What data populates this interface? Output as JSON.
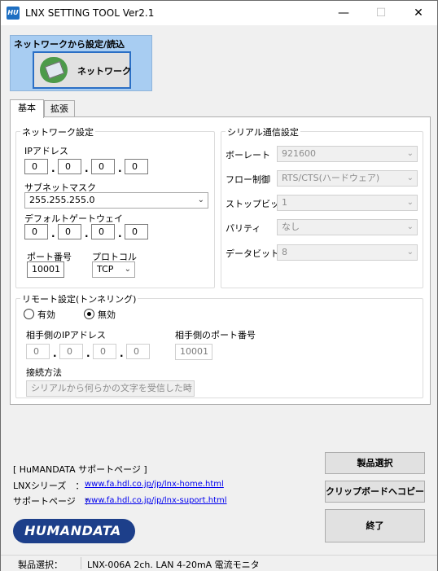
{
  "window": {
    "app_icon": "HU",
    "title": "LNX SETTING TOOL Ver2.1",
    "minimize": "—",
    "maximize": "☐",
    "close": "✕"
  },
  "network_panel": {
    "title": "ネットワークから設定/読込",
    "button_label": "ネットワーク",
    "button_icon": "network-plug-icon"
  },
  "tabs": [
    {
      "label": "基本",
      "active": true
    },
    {
      "label": "拡張",
      "active": false
    }
  ],
  "network_settings": {
    "group_title": "ネットワーク設定",
    "ip_label": "IPアドレス",
    "ip": [
      "0",
      "0",
      "0",
      "0"
    ],
    "subnet_label": "サブネットマスク",
    "subnet_value": "255.255.255.0",
    "gateway_label": "デフォルトゲートウェイ",
    "gateway": [
      "0",
      "0",
      "0",
      "0"
    ],
    "port_label": "ポート番号",
    "port_value": "10001",
    "protocol_label": "プロトコル",
    "protocol_value": "TCP"
  },
  "serial_settings": {
    "group_title": "シリアル通信設定",
    "baud_label": "ボーレート",
    "baud_value": "921600",
    "flow_label": "フロー制御",
    "flow_value": "RTS/CTS(ハードウェア)",
    "stopbit_label": "ストップビット",
    "stopbit_value": "1",
    "parity_label": "パリティ",
    "parity_value": "なし",
    "databit_label": "データビット",
    "databit_value": "8"
  },
  "remote_settings": {
    "group_title": "リモート設定(トンネリング)",
    "enable_label": "有効",
    "disable_label": "無効",
    "selected": "無効",
    "remote_ip_label": "相手側のIPアドレス",
    "remote_ip": [
      "0",
      "0",
      "0",
      "0"
    ],
    "remote_port_label": "相手側のポート番号",
    "remote_port_value": "10001",
    "connect_label": "接続方法",
    "connect_value": "シリアルから何らかの文字を受信した時"
  },
  "support": {
    "heading": "[ HuMANDATA サポートページ ]",
    "series_label": "LNXシリーズ　：",
    "series_link": "www.fa.hdl.co.jp/jp/lnx-home.html",
    "support_label": "サポートページ　：",
    "support_link": "www.fa.hdl.co.jp/jp/lnx-suport.html",
    "logo_text": "HUMANDATA"
  },
  "buttons": {
    "product_select": "製品選択",
    "clipboard_copy": "クリップボードへコピー",
    "exit": "終了"
  },
  "status": {
    "label": "製品選択：",
    "value": "LNX-006A 2ch. LAN 4-20mA 電流モニタ"
  }
}
